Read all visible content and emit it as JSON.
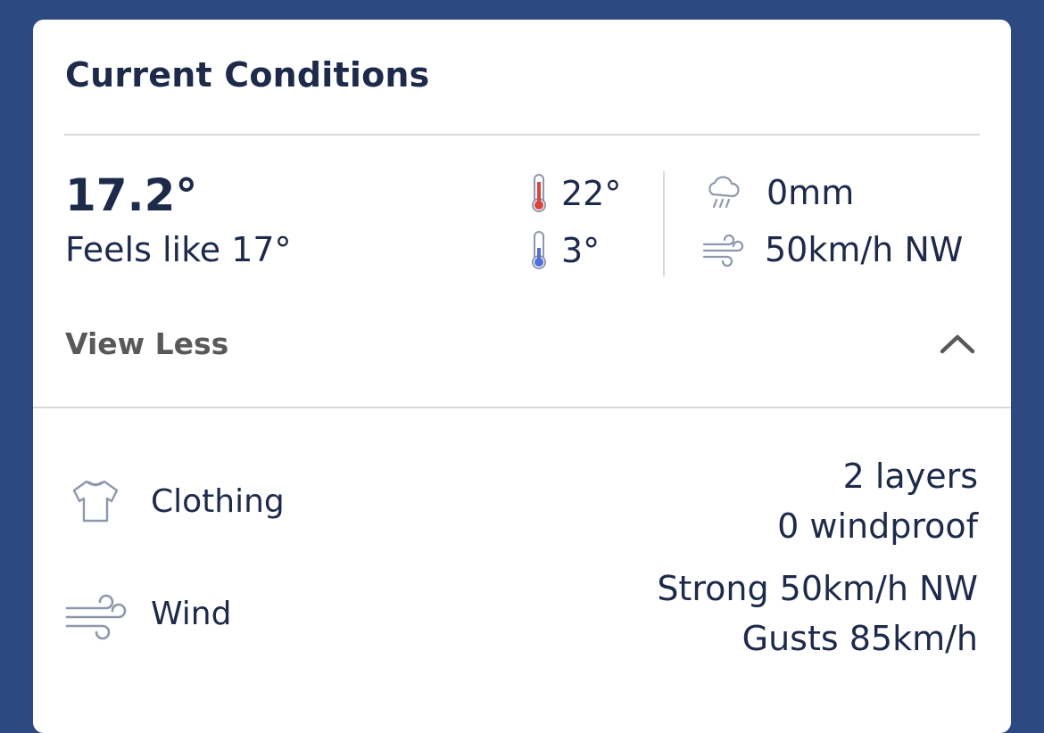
{
  "header": {
    "title": "Current Conditions"
  },
  "current": {
    "temperature": "17.2°",
    "feels_like": "Feels like 17°",
    "max_temp": "22°",
    "min_temp": "3°",
    "rainfall": "0mm",
    "wind": "50km/h NW"
  },
  "toggle": {
    "label": "View Less"
  },
  "details": {
    "clothing": {
      "label": "Clothing",
      "line1": "2 layers",
      "line2": "0 windproof"
    },
    "wind": {
      "label": "Wind",
      "line1": "Strong 50km/h NW",
      "line2": "Gusts 85km/h"
    }
  },
  "icons": {
    "max_temp": "thermometer-hot-icon",
    "min_temp": "thermometer-cold-icon",
    "rain": "rain-cloud-icon",
    "wind": "wind-icon",
    "clothing": "shirt-icon",
    "chevron": "chevron-up-icon"
  },
  "colors": {
    "background": "#2c4a80",
    "card": "#ffffff",
    "text": "#1d2a4a",
    "muted": "#595959",
    "hot": "#d9453b",
    "cold": "#4e6fd8",
    "icon_gray": "#8f97ad"
  }
}
